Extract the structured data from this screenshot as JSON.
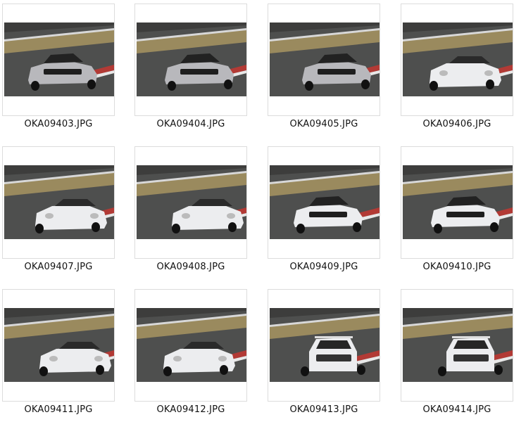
{
  "gallery": {
    "items": [
      {
        "filename": "OKA09403.JPG",
        "car": "silver-roadster"
      },
      {
        "filename": "OKA09404.JPG",
        "car": "silver-roadster"
      },
      {
        "filename": "OKA09405.JPG",
        "car": "silver-roadster"
      },
      {
        "filename": "OKA09406.JPG",
        "car": "white-porsche"
      },
      {
        "filename": "OKA09407.JPG",
        "car": "white-porsche"
      },
      {
        "filename": "OKA09408.JPG",
        "car": "white-porsche"
      },
      {
        "filename": "OKA09409.JPG",
        "car": "white-roadster"
      },
      {
        "filename": "OKA09410.JPG",
        "car": "white-roadster"
      },
      {
        "filename": "OKA09411.JPG",
        "car": "white-porsche"
      },
      {
        "filename": "OKA09412.JPG",
        "car": "white-porsche"
      },
      {
        "filename": "OKA09413.JPG",
        "car": "white-sedan"
      },
      {
        "filename": "OKA09414.JPG",
        "car": "white-sedan"
      }
    ]
  },
  "colors": {
    "track": "#4e4f4e",
    "grass": "#9a8a5e",
    "kerb_red": "#b23a35",
    "silver_car": "#b8b8bc",
    "white_car": "#ecedef",
    "border": "#dcdcdc"
  }
}
